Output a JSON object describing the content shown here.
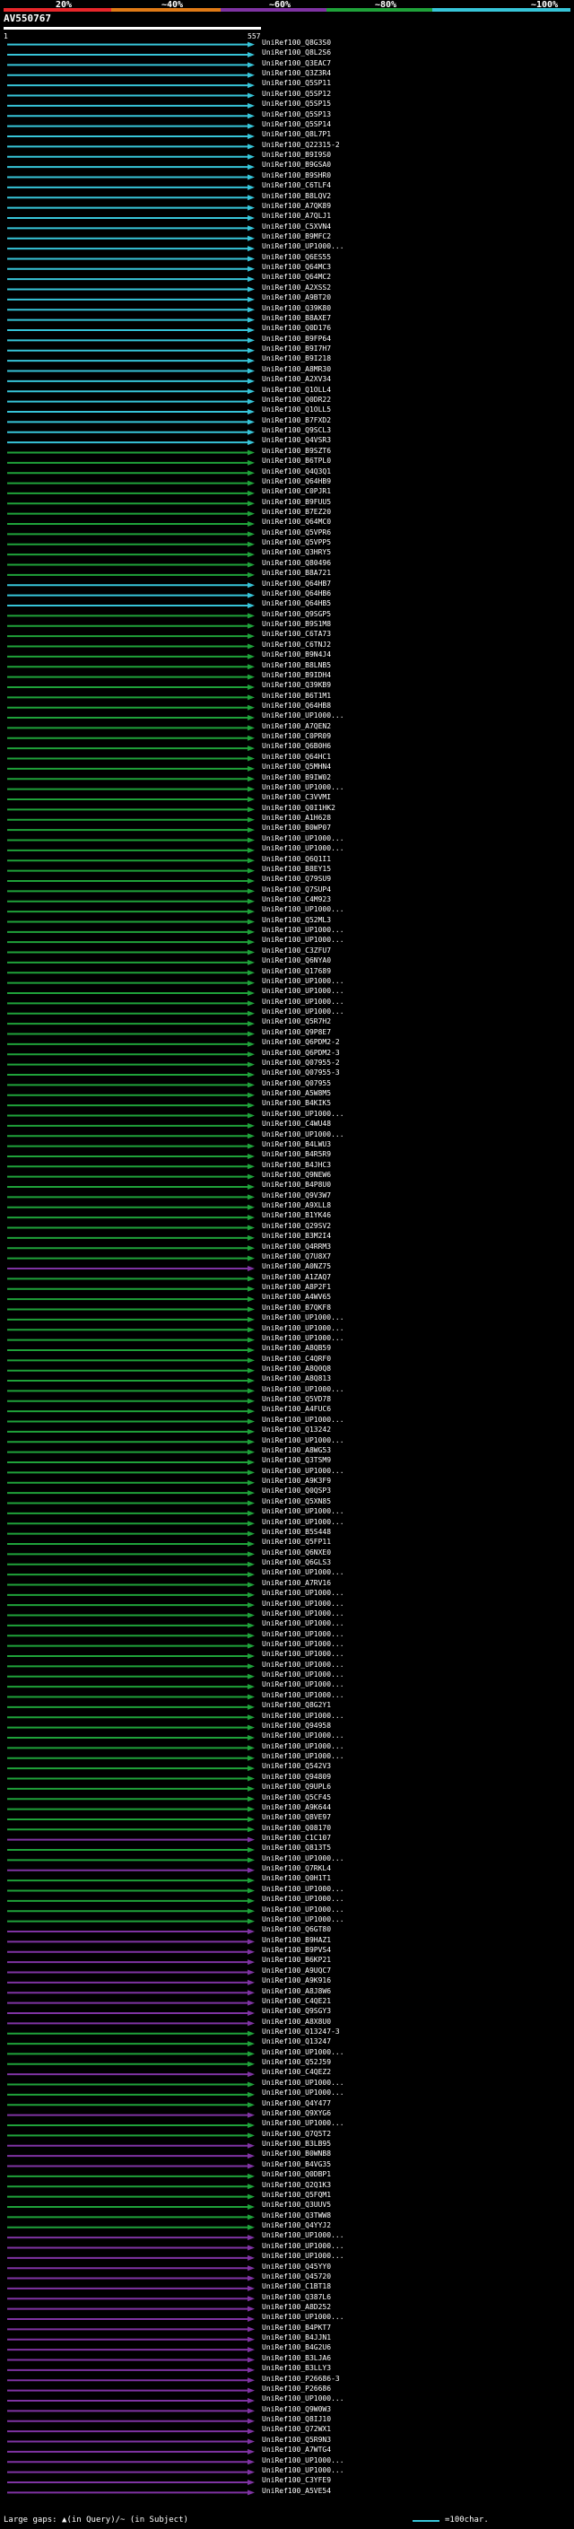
{
  "legend": {
    "labels": [
      "20%",
      "~40%",
      "~60%",
      "~80%",
      "~100%"
    ],
    "colors": [
      "#e8262a",
      "#e07a16",
      "#7f33a3",
      "#1fa23a",
      "#37c5d9"
    ]
  },
  "query": {
    "name": "AV550767",
    "start": "1",
    "end": "557"
  },
  "hits": [
    {
      "label": "UniRef100_Q8G3S0",
      "c": 4
    },
    {
      "label": "UniRef100_Q8L2S6",
      "c": 4
    },
    {
      "label": "UniRef100_Q3EAC7",
      "c": 4
    },
    {
      "label": "UniRef100_Q3Z3R4",
      "c": 4
    },
    {
      "label": "UniRef100_Q5SP11",
      "c": 4
    },
    {
      "label": "UniRef100_Q5SP12",
      "c": 4
    },
    {
      "label": "UniRef100_Q5SP15",
      "c": 4
    },
    {
      "label": "UniRef100_Q5SP13",
      "c": 4
    },
    {
      "label": "UniRef100_Q5SP14",
      "c": 4
    },
    {
      "label": "UniRef100_Q8L7P1",
      "c": 4
    },
    {
      "label": "UniRef100_Q22315-2",
      "c": 4
    },
    {
      "label": "UniRef100_B9I9S0",
      "c": 4
    },
    {
      "label": "UniRef100_B9GSA0",
      "c": 4
    },
    {
      "label": "UniRef100_B9SHR0",
      "c": 4
    },
    {
      "label": "UniRef100_C6TLF4",
      "c": 4
    },
    {
      "label": "UniRef100_B8LQV2",
      "c": 4
    },
    {
      "label": "UniRef100_A7QK89",
      "c": 4
    },
    {
      "label": "UniRef100_A7QLJ1",
      "c": 4
    },
    {
      "label": "UniRef100_C5XVN4",
      "c": 4
    },
    {
      "label": "UniRef100_B9MFC2",
      "c": 4
    },
    {
      "label": "UniRef100_UP1000...",
      "c": 4
    },
    {
      "label": "UniRef100_Q6ES55",
      "c": 4
    },
    {
      "label": "UniRef100_Q64MC3",
      "c": 4
    },
    {
      "label": "UniRef100_Q64MC2",
      "c": 4
    },
    {
      "label": "UniRef100_A2XSS2",
      "c": 4
    },
    {
      "label": "UniRef100_A9BT20",
      "c": 4
    },
    {
      "label": "UniRef100_Q39K80",
      "c": 4
    },
    {
      "label": "UniRef100_B8AXE7",
      "c": 4
    },
    {
      "label": "UniRef100_Q0D176",
      "c": 4
    },
    {
      "label": "UniRef100_B9FP64",
      "c": 4
    },
    {
      "label": "UniRef100_B9I7H7",
      "c": 4
    },
    {
      "label": "UniRef100_B9I218",
      "c": 4
    },
    {
      "label": "UniRef100_A8MR30",
      "c": 4
    },
    {
      "label": "UniRef100_A2XV34",
      "c": 4
    },
    {
      "label": "UniRef100_Q1OLL4",
      "c": 4
    },
    {
      "label": "UniRef100_Q0DR22",
      "c": 4
    },
    {
      "label": "UniRef100_Q1OLL5",
      "c": 4
    },
    {
      "label": "UniRef100_B7FXD2",
      "c": 4
    },
    {
      "label": "UniRef100_Q9SCL3",
      "c": 4
    },
    {
      "label": "UniRef100_Q4VSR3",
      "c": 4
    },
    {
      "label": "UniRef100_B9SZT6",
      "c": 3
    },
    {
      "label": "UniRef100_B6TPL0",
      "c": 3
    },
    {
      "label": "UniRef100_Q4Q3Q1",
      "c": 3
    },
    {
      "label": "UniRef100_Q64HB9",
      "c": 3
    },
    {
      "label": "UniRef100_C0PJR1",
      "c": 3
    },
    {
      "label": "UniRef100_B9FUU5",
      "c": 3
    },
    {
      "label": "UniRef100_B7EZ20",
      "c": 3
    },
    {
      "label": "UniRef100_Q64MC0",
      "c": 3
    },
    {
      "label": "UniRef100_Q5VPR6",
      "c": 3
    },
    {
      "label": "UniRef100_Q5VPP5",
      "c": 3
    },
    {
      "label": "UniRef100_Q3HRY5",
      "c": 3
    },
    {
      "label": "UniRef100_Q80496",
      "c": 3
    },
    {
      "label": "UniRef100_B8A721",
      "c": 3
    },
    {
      "label": "UniRef100_Q64HB7",
      "c": 4
    },
    {
      "label": "UniRef100_Q64HB6",
      "c": 4
    },
    {
      "label": "UniRef100_Q64HB5",
      "c": 4
    },
    {
      "label": "UniRef100_Q9SGP5",
      "c": 3
    },
    {
      "label": "UniRef100_B9S1M8",
      "c": 3
    },
    {
      "label": "UniRef100_C6TA73",
      "c": 3
    },
    {
      "label": "UniRef100_C6TNJ2",
      "c": 3
    },
    {
      "label": "UniRef100_B9N4J4",
      "c": 3
    },
    {
      "label": "UniRef100_B8LNB5",
      "c": 3
    },
    {
      "label": "UniRef100_B9IDH4",
      "c": 3
    },
    {
      "label": "UniRef100_Q39KB9",
      "c": 3
    },
    {
      "label": "UniRef100_B6T1M1",
      "c": 3
    },
    {
      "label": "UniRef100_Q64HB8",
      "c": 3
    },
    {
      "label": "UniRef100_UP1000...",
      "c": 3
    },
    {
      "label": "UniRef100_A7QEN2",
      "c": 3
    },
    {
      "label": "UniRef100_C0PR09",
      "c": 3
    },
    {
      "label": "UniRef100_Q6B0H6",
      "c": 3
    },
    {
      "label": "UniRef100_Q64HC1",
      "c": 3
    },
    {
      "label": "UniRef100_Q5MHN4",
      "c": 3
    },
    {
      "label": "UniRef100_B9IW02",
      "c": 3
    },
    {
      "label": "UniRef100_UP1000...",
      "c": 3
    },
    {
      "label": "UniRef100_C3VVMI",
      "c": 3
    },
    {
      "label": "UniRef100_Q0I1HK2",
      "c": 3
    },
    {
      "label": "UniRef100_A1H628",
      "c": 3
    },
    {
      "label": "UniRef100_B0WP07",
      "c": 3
    },
    {
      "label": "UniRef100_UP1000...",
      "c": 3
    },
    {
      "label": "UniRef100_UP1000...",
      "c": 3
    },
    {
      "label": "UniRef100_Q6Q1I1",
      "c": 3
    },
    {
      "label": "UniRef100_B8EY15",
      "c": 3
    },
    {
      "label": "UniRef100_Q79SU9",
      "c": 3
    },
    {
      "label": "UniRef100_Q7SUP4",
      "c": 3
    },
    {
      "label": "UniRef100_C4M923",
      "c": 3
    },
    {
      "label": "UniRef100_UP1000...",
      "c": 3
    },
    {
      "label": "UniRef100_Q52ML3",
      "c": 3
    },
    {
      "label": "UniRef100_UP1000...",
      "c": 3
    },
    {
      "label": "UniRef100_UP1000...",
      "c": 3
    },
    {
      "label": "UniRef100_C3ZFU7",
      "c": 3
    },
    {
      "label": "UniRef100_Q6NYA0",
      "c": 3
    },
    {
      "label": "UniRef100_Q17689",
      "c": 3
    },
    {
      "label": "UniRef100_UP1000...",
      "c": 3
    },
    {
      "label": "UniRef100_UP1000...",
      "c": 3
    },
    {
      "label": "UniRef100_UP1000...",
      "c": 3
    },
    {
      "label": "UniRef100_UP1000...",
      "c": 3
    },
    {
      "label": "UniRef100_Q5R7H2",
      "c": 3
    },
    {
      "label": "UniRef100_Q9P8E7",
      "c": 3
    },
    {
      "label": "UniRef100_Q6PDM2-2",
      "c": 3
    },
    {
      "label": "UniRef100_Q6PDM2-3",
      "c": 3
    },
    {
      "label": "UniRef100_Q07955-2",
      "c": 3
    },
    {
      "label": "UniRef100_Q07955-3",
      "c": 3
    },
    {
      "label": "UniRef100_Q07955",
      "c": 3
    },
    {
      "label": "UniRef100_A5W8M5",
      "c": 3
    },
    {
      "label": "UniRef100_B4KIK5",
      "c": 3
    },
    {
      "label": "UniRef100_UP1000...",
      "c": 3
    },
    {
      "label": "UniRef100_C4WU48",
      "c": 3
    },
    {
      "label": "UniRef100_UP1000...",
      "c": 3
    },
    {
      "label": "UniRef100_B4LWU3",
      "c": 3
    },
    {
      "label": "UniRef100_B4R5R9",
      "c": 3
    },
    {
      "label": "UniRef100_B4JHC3",
      "c": 3
    },
    {
      "label": "UniRef100_Q9NEW6",
      "c": 3
    },
    {
      "label": "UniRef100_B4P8U0",
      "c": 3
    },
    {
      "label": "UniRef100_Q9V3W7",
      "c": 3
    },
    {
      "label": "UniRef100_A9XLL8",
      "c": 3
    },
    {
      "label": "UniRef100_B1YK46",
      "c": 3
    },
    {
      "label": "UniRef100_Q29SV2",
      "c": 3
    },
    {
      "label": "UniRef100_B3M2I4",
      "c": 3
    },
    {
      "label": "UniRef100_Q4RRM3",
      "c": 3
    },
    {
      "label": "UniRef100_Q7U8X7",
      "c": 3
    },
    {
      "label": "UniRef100_A0NZ75",
      "c": 2
    },
    {
      "label": "UniRef100_A1ZAQ7",
      "c": 3
    },
    {
      "label": "UniRef100_A8P2F1",
      "c": 3
    },
    {
      "label": "UniRef100_A4WV65",
      "c": 3
    },
    {
      "label": "UniRef100_B7QKF8",
      "c": 3
    },
    {
      "label": "UniRef100_UP1000...",
      "c": 3
    },
    {
      "label": "UniRef100_UP1000...",
      "c": 3
    },
    {
      "label": "UniRef100_UP1000...",
      "c": 3
    },
    {
      "label": "UniRef100_A8QB59",
      "c": 3
    },
    {
      "label": "UniRef100_C4QRF0",
      "c": 3
    },
    {
      "label": "UniRef100_A8Q0Q8",
      "c": 3
    },
    {
      "label": "UniRef100_A8Q813",
      "c": 3
    },
    {
      "label": "UniRef100_UP1000...",
      "c": 3
    },
    {
      "label": "UniRef100_Q5VD78",
      "c": 3
    },
    {
      "label": "UniRef100_A4FUC6",
      "c": 3
    },
    {
      "label": "UniRef100_UP1000...",
      "c": 3
    },
    {
      "label": "UniRef100_Q13242",
      "c": 3
    },
    {
      "label": "UniRef100_UP1000...",
      "c": 3
    },
    {
      "label": "UniRef100_A8WG53",
      "c": 3
    },
    {
      "label": "UniRef100_Q3TSM9",
      "c": 3
    },
    {
      "label": "UniRef100_UP1000...",
      "c": 3
    },
    {
      "label": "UniRef100_A9K3F9",
      "c": 3
    },
    {
      "label": "UniRef100_Q0QSP3",
      "c": 3
    },
    {
      "label": "UniRef100_Q5XN85",
      "c": 3
    },
    {
      "label": "UniRef100_UP1000...",
      "c": 3
    },
    {
      "label": "UniRef100_UP1000...",
      "c": 3
    },
    {
      "label": "UniRef100_B5S448",
      "c": 3
    },
    {
      "label": "UniRef100_Q5FP11",
      "c": 3
    },
    {
      "label": "UniRef100_Q6NXE0",
      "c": 3
    },
    {
      "label": "UniRef100_Q6GLS3",
      "c": 3
    },
    {
      "label": "UniRef100_UP1000...",
      "c": 3
    },
    {
      "label": "UniRef100_A7RV16",
      "c": 3
    },
    {
      "label": "UniRef100_UP1000...",
      "c": 3
    },
    {
      "label": "UniRef100_UP1000...",
      "c": 3
    },
    {
      "label": "UniRef100_UP1000...",
      "c": 3
    },
    {
      "label": "UniRef100_UP1000...",
      "c": 3
    },
    {
      "label": "UniRef100_UP1000...",
      "c": 3
    },
    {
      "label": "UniRef100_UP1000...",
      "c": 3
    },
    {
      "label": "UniRef100_UP1000...",
      "c": 3
    },
    {
      "label": "UniRef100_UP1000...",
      "c": 3
    },
    {
      "label": "UniRef100_UP1000...",
      "c": 3
    },
    {
      "label": "UniRef100_UP1000...",
      "c": 3
    },
    {
      "label": "UniRef100_UP1000...",
      "c": 3
    },
    {
      "label": "UniRef100_Q8G2Y1",
      "c": 3
    },
    {
      "label": "UniRef100_UP1000...",
      "c": 3
    },
    {
      "label": "UniRef100_Q94958",
      "c": 3
    },
    {
      "label": "UniRef100_UP1000...",
      "c": 3
    },
    {
      "label": "UniRef100_UP1000...",
      "c": 3
    },
    {
      "label": "UniRef100_UP1000...",
      "c": 3
    },
    {
      "label": "UniRef100_Q542V3",
      "c": 3
    },
    {
      "label": "UniRef100_Q94809",
      "c": 3
    },
    {
      "label": "UniRef100_Q9UPL6",
      "c": 3
    },
    {
      "label": "UniRef100_Q5CF45",
      "c": 3
    },
    {
      "label": "UniRef100_A9K644",
      "c": 3
    },
    {
      "label": "UniRef100_Q8VE97",
      "c": 3
    },
    {
      "label": "UniRef100_Q08170",
      "c": 3
    },
    {
      "label": "UniRef100_C1C107",
      "c": 2
    },
    {
      "label": "UniRef100_Q813T5",
      "c": 3
    },
    {
      "label": "UniRef100_UP1000...",
      "c": 3
    },
    {
      "label": "UniRef100_Q7RKL4",
      "c": 2
    },
    {
      "label": "UniRef100_Q0H1T1",
      "c": 3
    },
    {
      "label": "UniRef100_UP1000...",
      "c": 3
    },
    {
      "label": "UniRef100_UP1000...",
      "c": 3
    },
    {
      "label": "UniRef100_UP1000...",
      "c": 3
    },
    {
      "label": "UniRef100_UP1000...",
      "c": 3
    },
    {
      "label": "UniRef100_Q6GT80",
      "c": 2
    },
    {
      "label": "UniRef100_B9HAZ1",
      "c": 2
    },
    {
      "label": "UniRef100_B9PVS4",
      "c": 2
    },
    {
      "label": "UniRef100_B6KP21",
      "c": 2
    },
    {
      "label": "UniRef100_A9UQC7",
      "c": 2
    },
    {
      "label": "UniRef100_A9K916",
      "c": 2
    },
    {
      "label": "UniRef100_A8J8W6",
      "c": 2
    },
    {
      "label": "UniRef100_C4QE21",
      "c": 2
    },
    {
      "label": "UniRef100_Q9SGY3",
      "c": 2
    },
    {
      "label": "UniRef100_A8X8U0",
      "c": 2
    },
    {
      "label": "UniRef100_Q13247-3",
      "c": 3
    },
    {
      "label": "UniRef100_Q13247",
      "c": 3
    },
    {
      "label": "UniRef100_UP1000...",
      "c": 3
    },
    {
      "label": "UniRef100_Q52J59",
      "c": 3
    },
    {
      "label": "UniRef100_C4QEZ2",
      "c": 2
    },
    {
      "label": "UniRef100_UP1000...",
      "c": 3
    },
    {
      "label": "UniRef100_UP1000...",
      "c": 3
    },
    {
      "label": "UniRef100_Q4Y477",
      "c": 3
    },
    {
      "label": "UniRef100_Q9XYG6",
      "c": 2
    },
    {
      "label": "UniRef100_UP1000...",
      "c": 3
    },
    {
      "label": "UniRef100_Q7Q5T2",
      "c": 3
    },
    {
      "label": "UniRef100_B3LB95",
      "c": 2
    },
    {
      "label": "UniRef100_B0WNB8",
      "c": 2
    },
    {
      "label": "UniRef100_B4VG35",
      "c": 2
    },
    {
      "label": "UniRef100_Q0DBP1",
      "c": 3
    },
    {
      "label": "UniRef100_Q2Q1K3",
      "c": 3
    },
    {
      "label": "UniRef100_Q5FQM1",
      "c": 3
    },
    {
      "label": "UniRef100_Q3UUV5",
      "c": 3
    },
    {
      "label": "UniRef100_Q3TWW8",
      "c": 3
    },
    {
      "label": "UniRef100_Q4YYJ2",
      "c": 3
    },
    {
      "label": "UniRef100_UP1000...",
      "c": 2
    },
    {
      "label": "UniRef100_UP1000...",
      "c": 2
    },
    {
      "label": "UniRef100_UP1000...",
      "c": 2
    },
    {
      "label": "UniRef100_Q45YY0",
      "c": 2
    },
    {
      "label": "UniRef100_Q45720",
      "c": 2
    },
    {
      "label": "UniRef100_C1BT18",
      "c": 2
    },
    {
      "label": "UniRef100_Q387L6",
      "c": 2
    },
    {
      "label": "UniRef100_A8D252",
      "c": 2
    },
    {
      "label": "UniRef100_UP1000...",
      "c": 2
    },
    {
      "label": "UniRef100_B4PKT7",
      "c": 2
    },
    {
      "label": "UniRef100_B4JJN1",
      "c": 2
    },
    {
      "label": "UniRef100_B4G2U6",
      "c": 2
    },
    {
      "label": "UniRef100_B3LJA6",
      "c": 2
    },
    {
      "label": "UniRef100_B3LLY3",
      "c": 2
    },
    {
      "label": "UniRef100_P26686-3",
      "c": 2
    },
    {
      "label": "UniRef100_P26686",
      "c": 2
    },
    {
      "label": "UniRef100_UP1000...",
      "c": 2
    },
    {
      "label": "UniRef100_Q9W0W3",
      "c": 2
    },
    {
      "label": "UniRef100_Q8IJ10",
      "c": 2
    },
    {
      "label": "UniRef100_Q72WX1",
      "c": 2
    },
    {
      "label": "UniRef100_Q5R9N3",
      "c": 2
    },
    {
      "label": "UniRef100_A7WTG4",
      "c": 2
    },
    {
      "label": "UniRef100_UP1000...",
      "c": 2
    },
    {
      "label": "UniRef100_UP1000...",
      "c": 2
    },
    {
      "label": "UniRef100_C3YFE9",
      "c": 2
    },
    {
      "label": "UniRef100_A5VE54",
      "c": 2
    }
  ],
  "footer": {
    "gaps_text": "Large gaps: ▲(in Query)/~ (in Subject)",
    "scale_text": "=100char."
  }
}
